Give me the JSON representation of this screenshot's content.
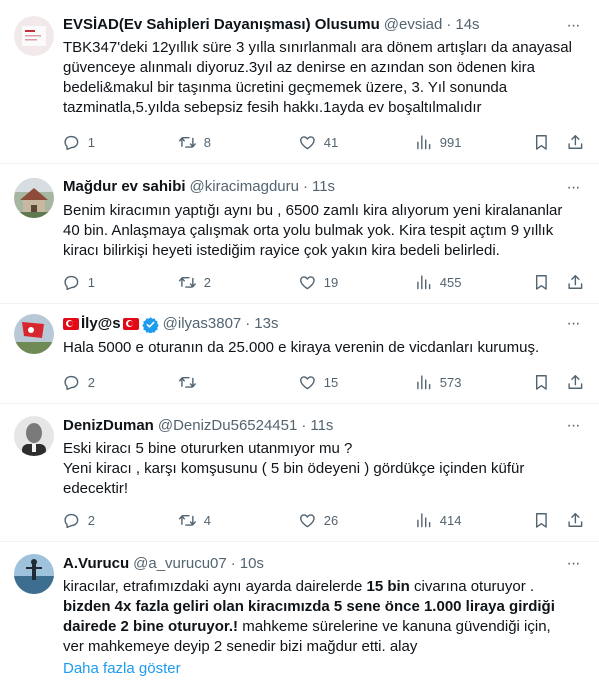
{
  "tweets": [
    {
      "name": "EVSİAD(Ev Sahipleri Dayanışması) Olusumu",
      "handle": "@evsiad",
      "time": "14s",
      "lines": [
        "TBK347'deki 12yıllık süre 3 yılla sınırlanmalı ara dönem artışları da anayasal",
        "güvenceye alınmalı diyoruz.3yıl az denirse en azından son ödenen kira",
        "bedeli&makul bir taşınma ücretini geçmemek üzere, 3. Yıl sonunda",
        "tazminatla,5.yılda  sebepsiz fesih hakkı.1ayda ev boşaltılmalıdır"
      ],
      "replies": "1",
      "retweets": "8",
      "likes": "41",
      "views": "991"
    },
    {
      "name": "Mağdur ev sahibi",
      "handle": "@kiracimagduru",
      "time": "11s",
      "lines": [
        "Benim kiracımın yaptığı aynı bu , 6500 zamlı kira alıyorum yeni kiralananlar",
        "40 bin.  Anlaşmaya çalışmak orta yolu bulmak yok. Kira tespit açtım 9 yıllık",
        "kiracı bilirkişi heyeti istediğim rayice çok yakın kira bedeli belirledi."
      ],
      "replies": "1",
      "retweets": "2",
      "likes": "19",
      "views": "455"
    },
    {
      "name": "İly@s",
      "handle": "@ilyas3807",
      "time": "13s",
      "lines": [
        "Hala 5000 e oturanın da 25.000 e kiraya verenin de vicdanları kurumuş."
      ],
      "replies": "2",
      "retweets": "",
      "likes": "15",
      "views": "573"
    },
    {
      "name": "DenizDuman",
      "handle": "@DenizDu56524451",
      "time": "11s",
      "lines": [
        "Eski kiracı 5 bine otururken utanmıyor mu ?",
        "Yeni kiracı , karşı  komşusunu ( 5 bin ödeyeni ) gördükçe  içinden küfür",
        "edecektir!"
      ],
      "replies": "2",
      "retweets": "4",
      "likes": "26",
      "views": "414"
    },
    {
      "name": "A.Vurucu",
      "handle": "@a_vurucu07",
      "time": "10s",
      "line1_pre": "kiracılar, etrafımızdaki aynı ayarda dairelerde ",
      "line1_bold": "15 bin",
      "line1_post": " civarına oturuyor .",
      "line2_bold": "bizden 4x fazla geliri olan kiracımızda 5 sene önce 1.000 liraya girdiği",
      "line3_bold": "dairede  2 bine oturuyor.!",
      "line3_post": " mahkeme sürelerine ve kanuna  güvendiği için,",
      "line4": "ver mahkemeye deyip 2 senedir bizi mağdur etti. alay",
      "show_more": "Daha fazla göster"
    }
  ],
  "separator": "·",
  "more_glyph": "···",
  "colors": {
    "text": "#0f1419",
    "muted": "#536471",
    "link": "#1d9bf0",
    "divider": "#eff3f4"
  },
  "icons": [
    "reply-icon",
    "retweet-icon",
    "like-icon",
    "views-icon",
    "bookmark-icon",
    "share-icon",
    "more-icon",
    "verified-badge-icon",
    "turkish-flag-icon"
  ]
}
